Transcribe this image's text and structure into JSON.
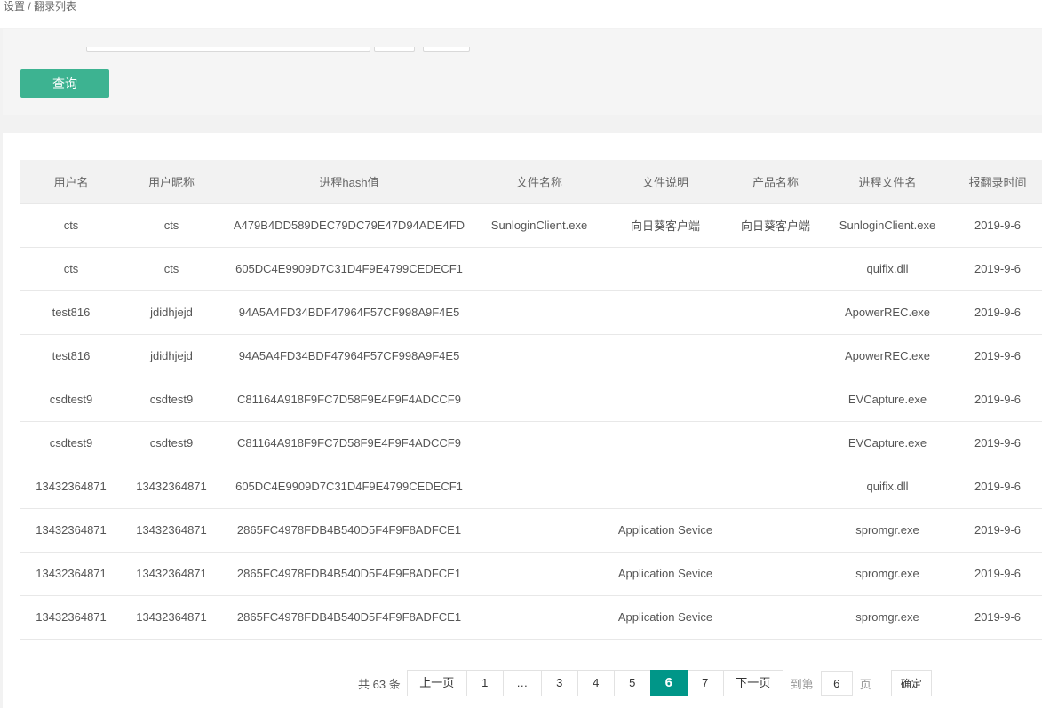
{
  "breadcrumb": {
    "parent": "设置",
    "separator": "/",
    "current": "翻录列表"
  },
  "search": {
    "query_label": "查询"
  },
  "table": {
    "columns": [
      "用户名",
      "用户昵称",
      "进程hash值",
      "文件名称",
      "文件说明",
      "产品名称",
      "进程文件名",
      "报翻录时间"
    ],
    "rows": [
      [
        "cts",
        "cts",
        "A479B4DD589DEC79DC79E47D94ADE4FD",
        "SunloginClient.exe",
        "向日葵客户端",
        "向日葵客户端",
        "SunloginClient.exe",
        "2019-9-6"
      ],
      [
        "cts",
        "cts",
        "605DC4E9909D7C31D4F9E4799CEDECF1",
        "",
        "",
        "",
        "quifix.dll",
        "2019-9-6"
      ],
      [
        "test816",
        "jdidhjejd",
        "94A5A4FD34BDF47964F57CF998A9F4E5",
        "",
        "",
        "",
        "ApowerREC.exe",
        "2019-9-6"
      ],
      [
        "test816",
        "jdidhjejd",
        "94A5A4FD34BDF47964F57CF998A9F4E5",
        "",
        "",
        "",
        "ApowerREC.exe",
        "2019-9-6"
      ],
      [
        "csdtest9",
        "csdtest9",
        "C81164A918F9FC7D58F9E4F9F4ADCCF9",
        "",
        "",
        "",
        "EVCapture.exe",
        "2019-9-6"
      ],
      [
        "csdtest9",
        "csdtest9",
        "C81164A918F9FC7D58F9E4F9F4ADCCF9",
        "",
        "",
        "",
        "EVCapture.exe",
        "2019-9-6"
      ],
      [
        "13432364871",
        "13432364871",
        "605DC4E9909D7C31D4F9E4799CEDECF1",
        "",
        "",
        "",
        "quifix.dll",
        "2019-9-6"
      ],
      [
        "13432364871",
        "13432364871",
        "2865FC4978FDB4B540D5F4F9F8ADFCE1",
        "",
        "Application Sevice",
        "",
        "spromgr.exe",
        "2019-9-6"
      ],
      [
        "13432364871",
        "13432364871",
        "2865FC4978FDB4B540D5F4F9F8ADFCE1",
        "",
        "Application Sevice",
        "",
        "spromgr.exe",
        "2019-9-6"
      ],
      [
        "13432364871",
        "13432364871",
        "2865FC4978FDB4B540D5F4F9F8ADFCE1",
        "",
        "Application Sevice",
        "",
        "spromgr.exe",
        "2019-9-6"
      ]
    ]
  },
  "pagination": {
    "total_prefix": "共",
    "total_count": "63",
    "total_suffix": "条",
    "prev_label": "上一页",
    "next_label": "下一页",
    "pages": [
      "1",
      "…",
      "3",
      "4",
      "5",
      "6",
      "7"
    ],
    "current_page": "6",
    "goto_prefix": "到第",
    "goto_value": "6",
    "goto_suffix": "页",
    "confirm_label": "确定"
  },
  "colors": {
    "accent": "#3db391",
    "current_page": "#009688"
  }
}
